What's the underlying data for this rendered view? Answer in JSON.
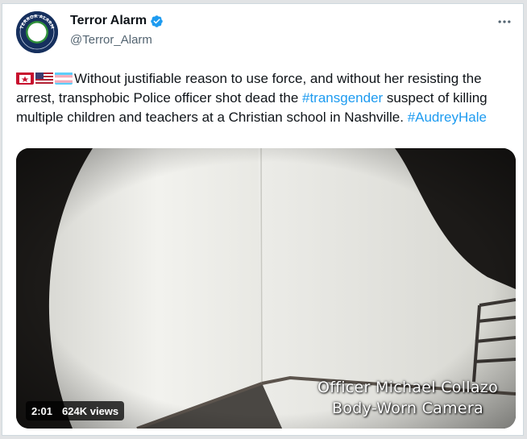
{
  "account": {
    "display_name": "Terror Alarm",
    "handle": "@Terror_Alarm",
    "verified": true,
    "avatar_icon": "terror-alarm-logo",
    "avatar_ring_text": "TERROR ALARM",
    "avatar_center_text": "TERROR ALARM"
  },
  "tweet": {
    "text_part1": "Without justifiable reason to use force, and without her resisting the arrest, transphobic Police officer shot dead the ",
    "hashtag1": "#transgender",
    "text_part2": " suspect of killing multiple children and teachers at a Christian school in Nashville. ",
    "hashtag2": "#AudreyHale",
    "emojis": [
      "red-banner-emoji",
      "us-flag-emoji",
      "transgender-flag-emoji"
    ]
  },
  "video": {
    "duration": "2:01",
    "views": "624K views",
    "caption_line1": "Officer Michael Collazo",
    "caption_line2": "Body-Worn Camera"
  },
  "colors": {
    "hashtag": "#1d9bf0",
    "verified": "#1d9bf0",
    "text": "#0f1419",
    "secondary": "#536471"
  }
}
